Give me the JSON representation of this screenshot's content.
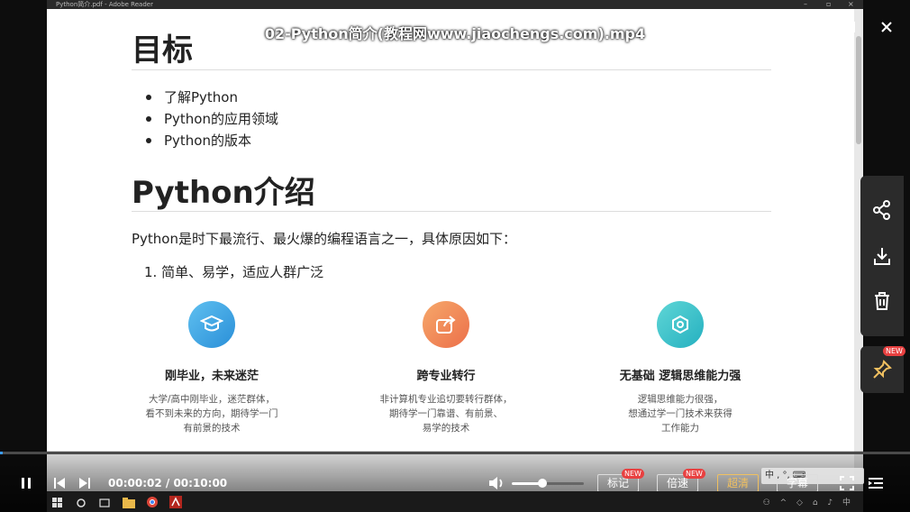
{
  "window": {
    "doc_window_title": "Python简介.pdf - Adobe Reader",
    "video_title": "02-Python简介(教程网www.jiaochengs.com).mp4"
  },
  "document": {
    "heading_1": "目标",
    "bullets": [
      "了解Python",
      "Python的应用领域",
      "Python的版本"
    ],
    "heading_2": "Python介绍",
    "paragraph": "Python是时下最流行、最火爆的编程语言之一，具体原因如下：",
    "numbered_item": "1.  简单、易学，适应人群广泛",
    "features": [
      {
        "title": "刚毕业，未来迷茫",
        "desc_lines": [
          "大学/高中刚毕业，迷茫群体，",
          "看不到未来的方向，期待学一门",
          "有前景的技术"
        ],
        "icon": "graduation-cap-icon",
        "color": "#3aa6e8"
      },
      {
        "title": "跨专业转行",
        "desc_lines": [
          "非计算机专业追切要转行群体，",
          "期待学一门靠谱、有前景、",
          "易学的技术"
        ],
        "icon": "share-arrow-icon",
        "color": "#f08a4b"
      },
      {
        "title": "无基础  逻辑思维能力强",
        "desc_lines": [
          "逻辑思维能力很强，",
          "想通过学一门技术来获得",
          "工作能力"
        ],
        "icon": "molecule-icon",
        "color": "#3cc6c8"
      }
    ]
  },
  "player": {
    "current_time": "00:00:02",
    "total_time": "00:10:00",
    "progress_fraction": 0.003,
    "volume_fraction": 0.42,
    "buttons": {
      "mark": "标记",
      "speed": "倍速",
      "quality": "超清",
      "subtitle": "字幕"
    },
    "new_badge": "NEW",
    "overlay_text": "中 ,  °,  ⌨"
  },
  "colors": {
    "accent": "#3b9cff",
    "badge": "#e84040",
    "quality_gold": "#f0c060"
  }
}
